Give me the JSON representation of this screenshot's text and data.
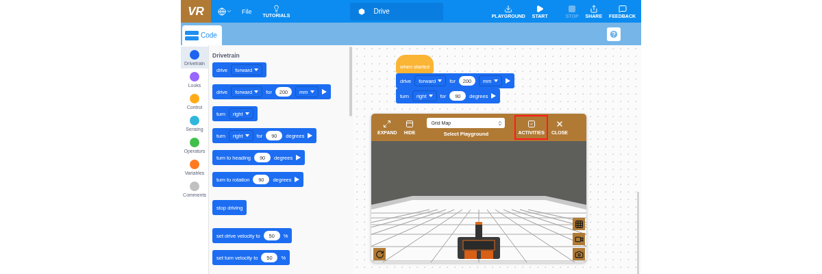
{
  "header": {
    "logo": "VR",
    "menu": [
      {
        "kind": "language"
      },
      {
        "kind": "text",
        "label": "File"
      },
      {
        "kind": "tutorials",
        "label": "TUTORIALS"
      }
    ],
    "project_title": "Drive",
    "actions": [
      {
        "kind": "playground",
        "label": "PLAYGROUND",
        "disabled": false
      },
      {
        "kind": "start",
        "label": "START",
        "disabled": false
      },
      {
        "kind": "stop",
        "label": "STOP",
        "disabled": true
      },
      {
        "kind": "share",
        "label": "SHARE",
        "disabled": false
      },
      {
        "kind": "feedback",
        "label": "FEEDBACK",
        "disabled": false
      }
    ]
  },
  "tab": {
    "label": "Code"
  },
  "categories": [
    {
      "label": "Drivetrain",
      "color": "#1d63f0",
      "selected": true
    },
    {
      "label": "Looks",
      "color": "#9966ff",
      "selected": false
    },
    {
      "label": "Control",
      "color": "#ffab19",
      "selected": false
    },
    {
      "label": "Sensing",
      "color": "#2fb6dc",
      "selected": false
    },
    {
      "label": "Operators",
      "color": "#40bf4a",
      "selected": false
    },
    {
      "label": "Variables",
      "color": "#ff7a1f",
      "selected": false
    },
    {
      "label": "Comments",
      "color": "#c0c0c0",
      "selected": false
    }
  ],
  "palette": {
    "title": "Drivetrain",
    "groups": [
      [
        {
          "parts": [
            {
              "kind": "text",
              "text": "drive"
            },
            {
              "kind": "dropdown",
              "text": "forward"
            }
          ]
        },
        {
          "parts": [
            {
              "kind": "text",
              "text": "drive"
            },
            {
              "kind": "dropdown",
              "text": "forward"
            },
            {
              "kind": "text",
              "text": "for"
            },
            {
              "kind": "number",
              "text": "200"
            },
            {
              "kind": "dropdown",
              "text": "mm"
            },
            {
              "kind": "run"
            }
          ]
        },
        {
          "parts": [
            {
              "kind": "text",
              "text": "turn"
            },
            {
              "kind": "dropdown",
              "text": "right"
            }
          ]
        },
        {
          "parts": [
            {
              "kind": "text",
              "text": "turn"
            },
            {
              "kind": "dropdown",
              "text": "right"
            },
            {
              "kind": "text",
              "text": "for"
            },
            {
              "kind": "number",
              "text": "90"
            },
            {
              "kind": "text",
              "text": "degrees"
            },
            {
              "kind": "run"
            }
          ]
        },
        {
          "parts": [
            {
              "kind": "text",
              "text": "turn to heading"
            },
            {
              "kind": "number",
              "text": "90"
            },
            {
              "kind": "text",
              "text": "degrees"
            },
            {
              "kind": "run"
            }
          ]
        },
        {
          "parts": [
            {
              "kind": "text",
              "text": "turn to rotation"
            },
            {
              "kind": "number",
              "text": "90"
            },
            {
              "kind": "text",
              "text": "degrees"
            },
            {
              "kind": "run"
            }
          ]
        }
      ],
      [
        {
          "parts": [
            {
              "kind": "text",
              "text": "stop driving"
            }
          ]
        }
      ],
      [
        {
          "parts": [
            {
              "kind": "text",
              "text": "set drive velocity to"
            },
            {
              "kind": "number",
              "text": "50"
            },
            {
              "kind": "text",
              "text": "%"
            }
          ]
        },
        {
          "parts": [
            {
              "kind": "text",
              "text": "set turn velocity to"
            },
            {
              "kind": "number",
              "text": "50"
            },
            {
              "kind": "text",
              "text": "%"
            }
          ]
        }
      ]
    ]
  },
  "script": {
    "hat": "when started",
    "blocks": [
      {
        "parts": [
          {
            "kind": "text",
            "text": "drive"
          },
          {
            "kind": "dropdown",
            "text": "forward"
          },
          {
            "kind": "text",
            "text": "for"
          },
          {
            "kind": "number",
            "text": "200"
          },
          {
            "kind": "dropdown",
            "text": "mm"
          },
          {
            "kind": "run"
          }
        ]
      },
      {
        "parts": [
          {
            "kind": "text",
            "text": "turn"
          },
          {
            "kind": "dropdown",
            "text": "right"
          },
          {
            "kind": "text",
            "text": "for"
          },
          {
            "kind": "number",
            "text": "90"
          },
          {
            "kind": "text",
            "text": "degrees"
          },
          {
            "kind": "run"
          }
        ]
      }
    ]
  },
  "playground": {
    "left_tools": [
      {
        "kind": "expand",
        "label": "EXPAND"
      },
      {
        "kind": "hide",
        "label": "HIDE"
      }
    ],
    "select": {
      "value": "Grid Map",
      "caption": "Select Playground"
    },
    "right_tools": [
      {
        "kind": "activities",
        "label": "ACTIVITIES",
        "highlighted": true
      },
      {
        "kind": "close",
        "label": "CLOSE",
        "highlighted": false
      }
    ]
  }
}
